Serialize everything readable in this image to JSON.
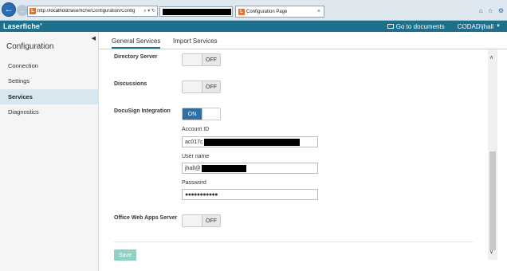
{
  "browser": {
    "url_prefix": "http://",
    "url_host": "localhost",
    "url_path": "/laserfiche/Configuration/Config",
    "address_controls": "⌕ ▾ ↻",
    "tab_title": "Configuration Page",
    "tab_close": "×"
  },
  "header": {
    "logo": "Laserfiche",
    "logo_mark": "®",
    "go_to_documents": "Go to documents",
    "user": "CODAD\\jhall"
  },
  "sidebar": {
    "title": "Configuration",
    "items": [
      {
        "label": "Connection"
      },
      {
        "label": "Settings"
      },
      {
        "label": "Services"
      },
      {
        "label": "Diagnostics"
      }
    ]
  },
  "tabs": [
    {
      "label": "General Services"
    },
    {
      "label": "Import Services"
    }
  ],
  "services": {
    "directory_server": {
      "label": "Directory Server",
      "state": "OFF"
    },
    "discussions": {
      "label": "Discussions",
      "state": "OFF"
    },
    "docusign": {
      "label": "DocuSign Integration",
      "state": "ON",
      "account_id_label": "Account ID",
      "account_id_value": "ac017c",
      "user_name_label": "User name",
      "user_name_value": "jhall@",
      "password_label": "Password",
      "password_value": "●●●●●●●●●●●"
    },
    "office_web_apps": {
      "label": "Office Web Apps Server",
      "state": "OFF"
    }
  },
  "save_label": "Save",
  "colors": {
    "header_bg": "#1e6f8c",
    "toggle_on": "#2f6fa8",
    "save_disabled": "#8fd2c3",
    "active_nav": "#d6e7ef"
  }
}
